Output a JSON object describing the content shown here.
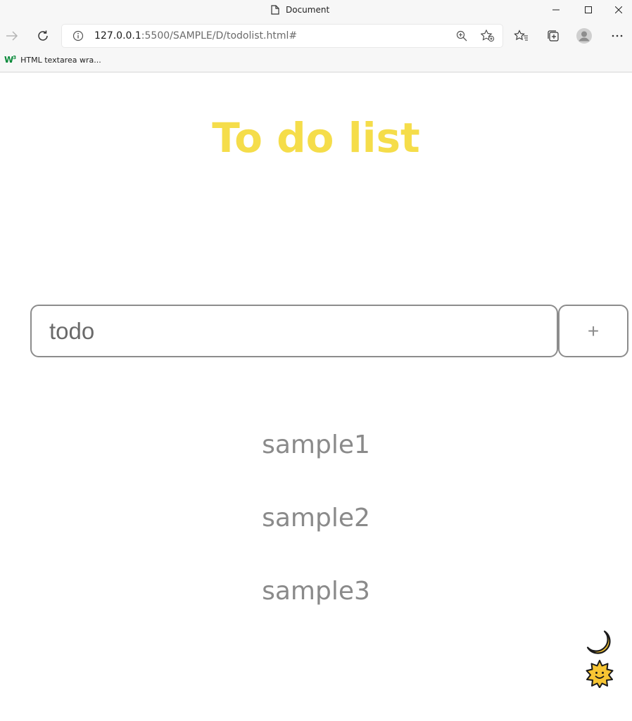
{
  "browser": {
    "tab_title": "Document",
    "url_host": "127.0.0.1",
    "url_rest": ":5500/SAMPLE/D/todolist.html#",
    "bookmark_label": "HTML textarea wra..."
  },
  "app": {
    "title": "To do list",
    "input_value": "todo",
    "add_label": "+",
    "items": [
      "sample1",
      "sample2",
      "sample3"
    ]
  },
  "icons": {
    "dark_mode": "moon-icon",
    "light_mode": "sun-icon"
  },
  "colors": {
    "title": "#f5dd4a",
    "item_text": "#8a8a8a",
    "border": "#8c8c8c"
  }
}
